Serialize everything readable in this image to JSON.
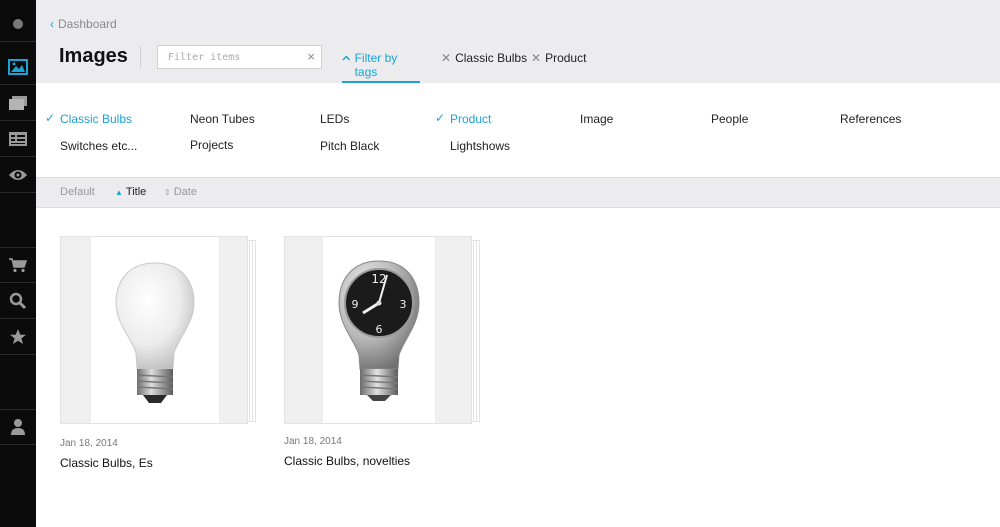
{
  "sidebar": {
    "items": [
      {
        "name": "profile-dot-icon"
      },
      {
        "name": "images-icon",
        "active": true
      },
      {
        "name": "folders-icon"
      },
      {
        "name": "list-icon"
      },
      {
        "name": "eye-icon"
      },
      {
        "name": "cart-icon"
      },
      {
        "name": "search-icon"
      },
      {
        "name": "star-icon"
      },
      {
        "name": "user-icon"
      }
    ]
  },
  "header": {
    "breadcrumb": "Dashboard",
    "title": "Images",
    "filter_placeholder": "Filter items",
    "filter_clear": "×",
    "filter_by_tags": "Filter by tags",
    "chips": [
      "Classic Bulbs",
      "Product"
    ]
  },
  "tags": [
    {
      "label": "Classic Bulbs",
      "active": true
    },
    {
      "label": "Neon Tubes",
      "active": false
    },
    {
      "label": "LEDs",
      "active": false
    },
    {
      "label": "Product",
      "active": true
    },
    {
      "label": "Image",
      "active": false
    },
    {
      "label": "People",
      "active": false
    },
    {
      "label": "References",
      "active": false
    },
    {
      "label": "Switches etc...",
      "active": false
    },
    {
      "label": "Projects",
      "active": false
    },
    {
      "label": "Pitch Black",
      "active": false
    },
    {
      "label": "Lightshows",
      "active": false
    }
  ],
  "sort": {
    "default": "Default",
    "title": "Title",
    "date": "Date",
    "active": "title"
  },
  "cards": [
    {
      "date": "Jan 18, 2014",
      "title": "Classic Bulbs, Es",
      "image": "white-light-bulb"
    },
    {
      "date": "Jan 18, 2014",
      "title": "Classic Bulbs, novelties",
      "image": "clock-light-bulb"
    }
  ],
  "colors": {
    "accent": "#1aa3d6",
    "sidebar": "#0b0b0b",
    "header_bg": "#ececee"
  }
}
